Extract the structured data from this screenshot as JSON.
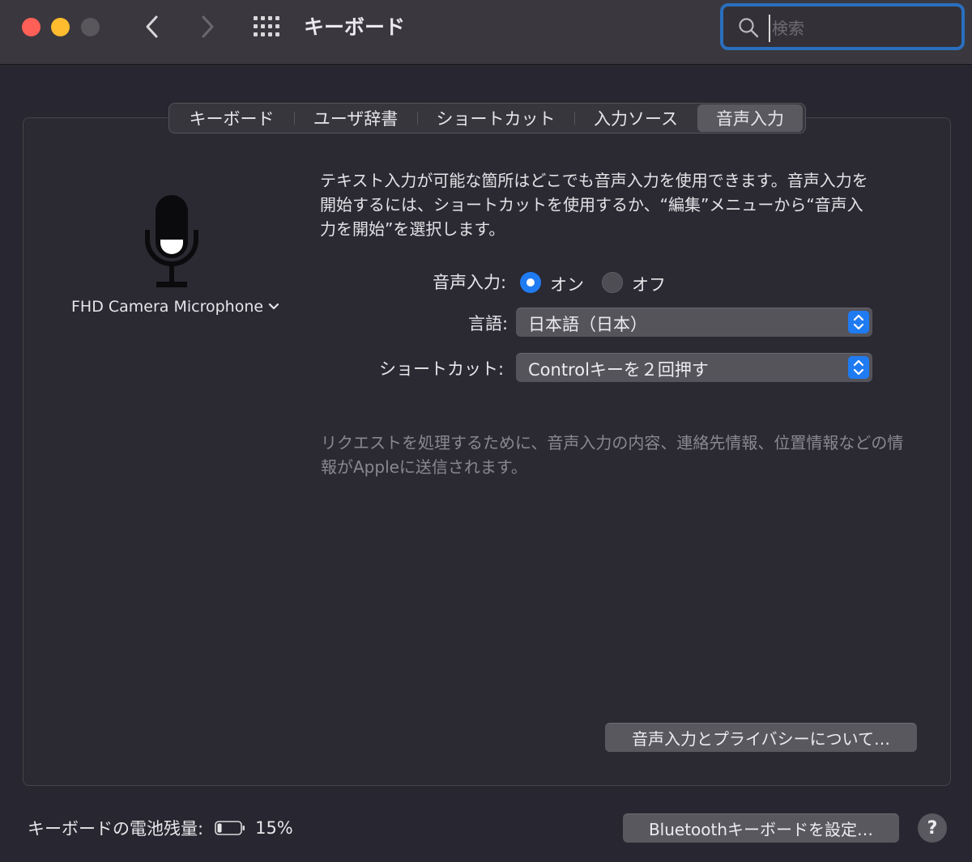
{
  "window": {
    "title": "キーボード",
    "search_placeholder": "検索"
  },
  "tabs": [
    {
      "label": "キーボード",
      "active": false
    },
    {
      "label": "ユーザ辞書",
      "active": false
    },
    {
      "label": "ショートカット",
      "active": false
    },
    {
      "label": "入力ソース",
      "active": false
    },
    {
      "label": "音声入力",
      "active": true
    }
  ],
  "microphone": {
    "selected": "FHD Camera Microphone"
  },
  "dictation": {
    "description": "テキスト入力が可能な箇所はどこでも音声入力を使用できます。音声入力を開始するには、ショートカットを使用するか、“編集”メニューから“音声入力を開始”を選択します。",
    "toggle_label": "音声入力:",
    "on_label": "オン",
    "off_label": "オフ",
    "state": "on",
    "language_label": "言語:",
    "language_value": "日本語（日本）",
    "shortcut_label": "ショートカット:",
    "shortcut_value": "Controlキーを２回押す",
    "privacy_notice": "リクエストを処理するために、音声入力の内容、連絡先情報、位置情報などの情報がAppleに送信されます。",
    "privacy_button": "音声入力とプライバシーについて…"
  },
  "footer": {
    "battery_label": "キーボードの電池残量:",
    "battery_percent": "15%",
    "battery_level": 0.15,
    "bluetooth_button": "Bluetoothキーボードを設定…",
    "help_label": "?"
  },
  "colors": {
    "accent": "#1f7bf2",
    "close": "#fe5f57",
    "minimize": "#febc2e",
    "zoom_disabled": "#59575c",
    "search_focus": "#2a6fbe"
  }
}
